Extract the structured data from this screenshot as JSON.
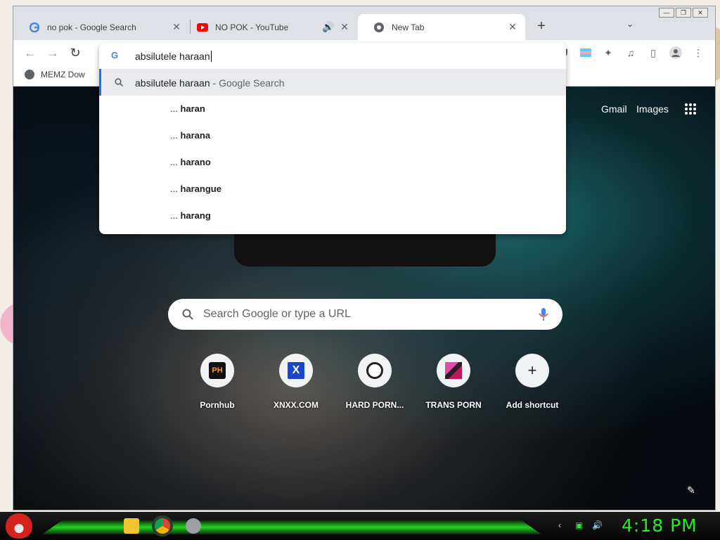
{
  "tabs": [
    {
      "title": "no pok - Google Search",
      "favicon": "google-icon"
    },
    {
      "title": "NO POK - YouTube",
      "favicon": "youtube-icon",
      "audio": true
    },
    {
      "title": "New Tab",
      "favicon": "chrome-newtab-icon",
      "active": true
    }
  ],
  "bookmarks": [
    {
      "label": "MEMZ Dow"
    }
  ],
  "omnibox": {
    "input": "absilutele haraan",
    "top_suggestion": {
      "query": "absilutele haraan",
      "suffix": " - Google Search"
    },
    "suggestions": [
      {
        "prefix": "... ",
        "bold": "haran"
      },
      {
        "prefix": "... ",
        "bold": "harana"
      },
      {
        "prefix": "... ",
        "bold": "harano"
      },
      {
        "prefix": "... ",
        "bold": "harangue"
      },
      {
        "prefix": "... ",
        "bold": "harang"
      }
    ]
  },
  "ntp": {
    "links": {
      "gmail": "Gmail",
      "images": "Images"
    },
    "search_placeholder": "Search Google or type a URL",
    "shortcuts": [
      {
        "label": "Pornhub",
        "icon_text": "PH"
      },
      {
        "label": "XNXX.COM",
        "icon_text": "X"
      },
      {
        "label": "HARD PORN...",
        "icon_text": ""
      },
      {
        "label": "TRANS PORN",
        "icon_text": ""
      },
      {
        "label": "Add shortcut",
        "icon_text": "+"
      }
    ]
  },
  "taskbar": {
    "clock": "4:18 PM"
  },
  "colors": {
    "accent": "#1a73e8",
    "clock": "#22ee22",
    "taskbar_glow": "#1fd41f"
  }
}
